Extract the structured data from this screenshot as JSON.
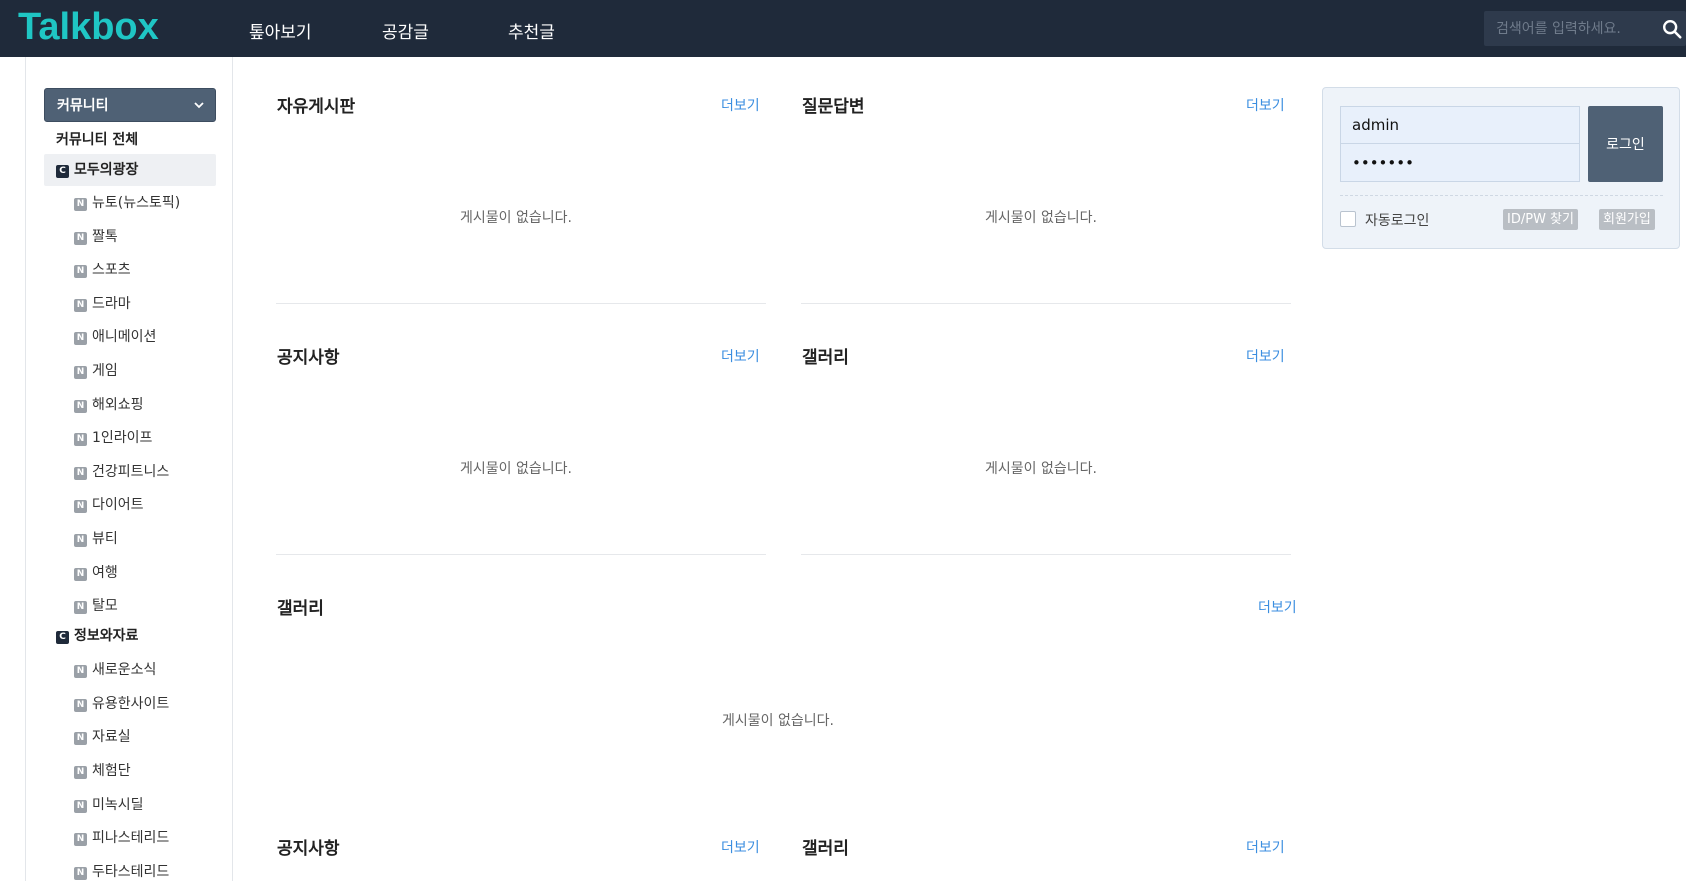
{
  "header": {
    "logo": "Talkbox",
    "nav": [
      "톺아보기",
      "공감글",
      "추천글"
    ],
    "search_placeholder": "검색어를 입력하세요."
  },
  "sidebar": {
    "select_label": "커뮤니티",
    "all_label": "커뮤니티 전체",
    "groups": [
      {
        "badge": "C",
        "label": "모두의광장",
        "items": [
          "뉴토(뉴스토픽)",
          "짤톡",
          "스포츠",
          "드라마",
          "애니메이션",
          "게임",
          "해외쇼핑",
          "1인라이프",
          "건강피트니스",
          "다이어트",
          "뷰티",
          "여행",
          "탈모"
        ]
      },
      {
        "badge": "C",
        "label": "정보와자료",
        "items": [
          "새로운소식",
          "유용한사이트",
          "자료실",
          "체험단",
          "미녹시딜",
          "피나스테리드",
          "두타스테리드"
        ]
      }
    ],
    "item_badge": "N"
  },
  "boards": [
    {
      "title": "자유게시판",
      "more": "더보기",
      "empty": "게시물이 없습니다."
    },
    {
      "title": "질문답변",
      "more": "더보기",
      "empty": "게시물이 없습니다."
    },
    {
      "title": "공지사항",
      "more": "더보기",
      "empty": "게시물이 없습니다."
    },
    {
      "title": "갤러리",
      "more": "더보기",
      "empty": "게시물이 없습니다."
    },
    {
      "title": "갤러리",
      "more": "더보기",
      "empty": "게시물이 없습니다."
    },
    {
      "title": "공지사항",
      "more": "더보기"
    },
    {
      "title": "갤러리",
      "more": "더보기"
    }
  ],
  "login": {
    "username": "admin",
    "password": "•••••••",
    "login_button": "로그인",
    "auto_login": "자동로그인",
    "find_idpw": "ID/PW 찾기",
    "signup": "회원가입"
  },
  "colors": {
    "header_bg": "#1f2a3a",
    "logo": "#1fc6c4",
    "accent_link": "#3b8ee0",
    "button_bg": "#4f6175"
  }
}
